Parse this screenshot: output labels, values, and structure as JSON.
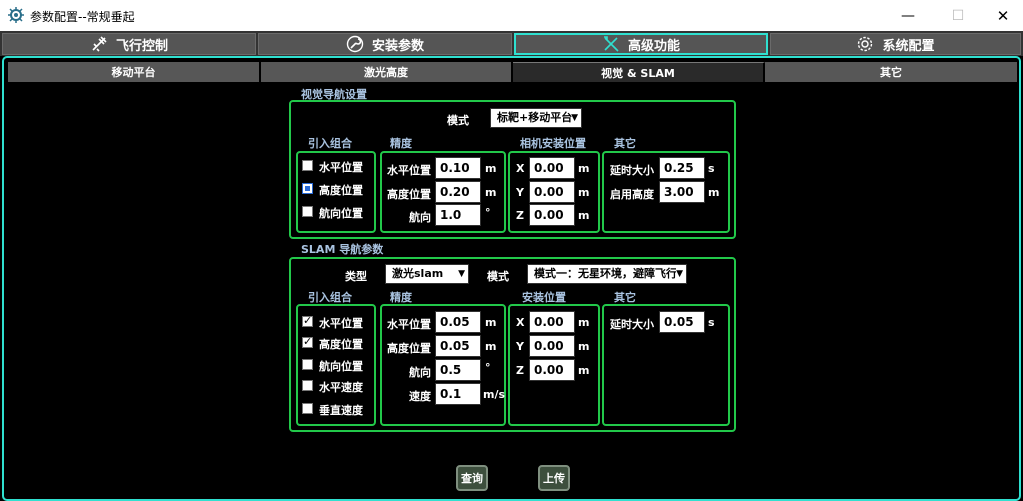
{
  "window": {
    "title": "参数配置--常规垂起",
    "minimize": "—",
    "maximize": "☐",
    "close": "✕"
  },
  "main_tabs": [
    {
      "label": "飞行控制",
      "icon": "airplane-icon"
    },
    {
      "label": "安装参数",
      "icon": "wrench-icon"
    },
    {
      "label": "高级功能",
      "icon": "tools-icon"
    },
    {
      "label": "系统配置",
      "icon": "gear-icon"
    }
  ],
  "active_main_tab": "高级功能",
  "sub_tabs": [
    "移动平台",
    "激光高度",
    "视觉 & SLAM",
    "其它"
  ],
  "active_sub_tab": "视觉 & SLAM",
  "visual": {
    "section_title": "视觉导航设置",
    "mode_label": "模式",
    "mode_value": "标靶+移动平台",
    "groups": {
      "combo": "引入组合",
      "precision": "精度",
      "camera": "相机安装位置",
      "other": "其它"
    },
    "combo_items": [
      {
        "label": "水平位置",
        "state": "unchecked"
      },
      {
        "label": "高度位置",
        "state": "focused"
      },
      {
        "label": "航向位置",
        "state": "unchecked"
      }
    ],
    "precision": [
      {
        "label": "水平位置",
        "value": "0.10",
        "unit": "m"
      },
      {
        "label": "高度位置",
        "value": "0.20",
        "unit": "m"
      },
      {
        "label": "航向",
        "value": "1.0",
        "unit": "°"
      }
    ],
    "camera": [
      {
        "label": "X",
        "value": "0.00",
        "unit": "m"
      },
      {
        "label": "Y",
        "value": "0.00",
        "unit": "m"
      },
      {
        "label": "Z",
        "value": "0.00",
        "unit": "m"
      }
    ],
    "other": [
      {
        "label": "延时大小",
        "value": "0.25",
        "unit": "s"
      },
      {
        "label": "启用高度",
        "value": "3.00",
        "unit": "m"
      }
    ]
  },
  "slam": {
    "section_title": "SLAM 导航参数",
    "type_label": "类型",
    "type_value": "激光slam",
    "mode_label": "模式",
    "mode_value": "模式一：无星环境，避障飞行",
    "groups": {
      "combo": "引入组合",
      "precision": "精度",
      "install": "安装位置",
      "other": "其它"
    },
    "combo_items": [
      {
        "label": "水平位置",
        "state": "checked"
      },
      {
        "label": "高度位置",
        "state": "checked"
      },
      {
        "label": "航向位置",
        "state": "unchecked"
      },
      {
        "label": "水平速度",
        "state": "unchecked"
      },
      {
        "label": "垂直速度",
        "state": "unchecked"
      }
    ],
    "precision": [
      {
        "label": "水平位置",
        "value": "0.05",
        "unit": "m"
      },
      {
        "label": "高度位置",
        "value": "0.05",
        "unit": "m"
      },
      {
        "label": "航向",
        "value": "0.5",
        "unit": "°"
      },
      {
        "label": "速度",
        "value": "0.1",
        "unit": "m/s"
      }
    ],
    "install": [
      {
        "label": "X",
        "value": "0.00",
        "unit": "m"
      },
      {
        "label": "Y",
        "value": "0.00",
        "unit": "m"
      },
      {
        "label": "Z",
        "value": "0.00",
        "unit": "m"
      }
    ],
    "other": [
      {
        "label": "延时大小",
        "value": "0.05",
        "unit": "s"
      }
    ]
  },
  "actions": {
    "query": "查询",
    "upload": "上传"
  }
}
